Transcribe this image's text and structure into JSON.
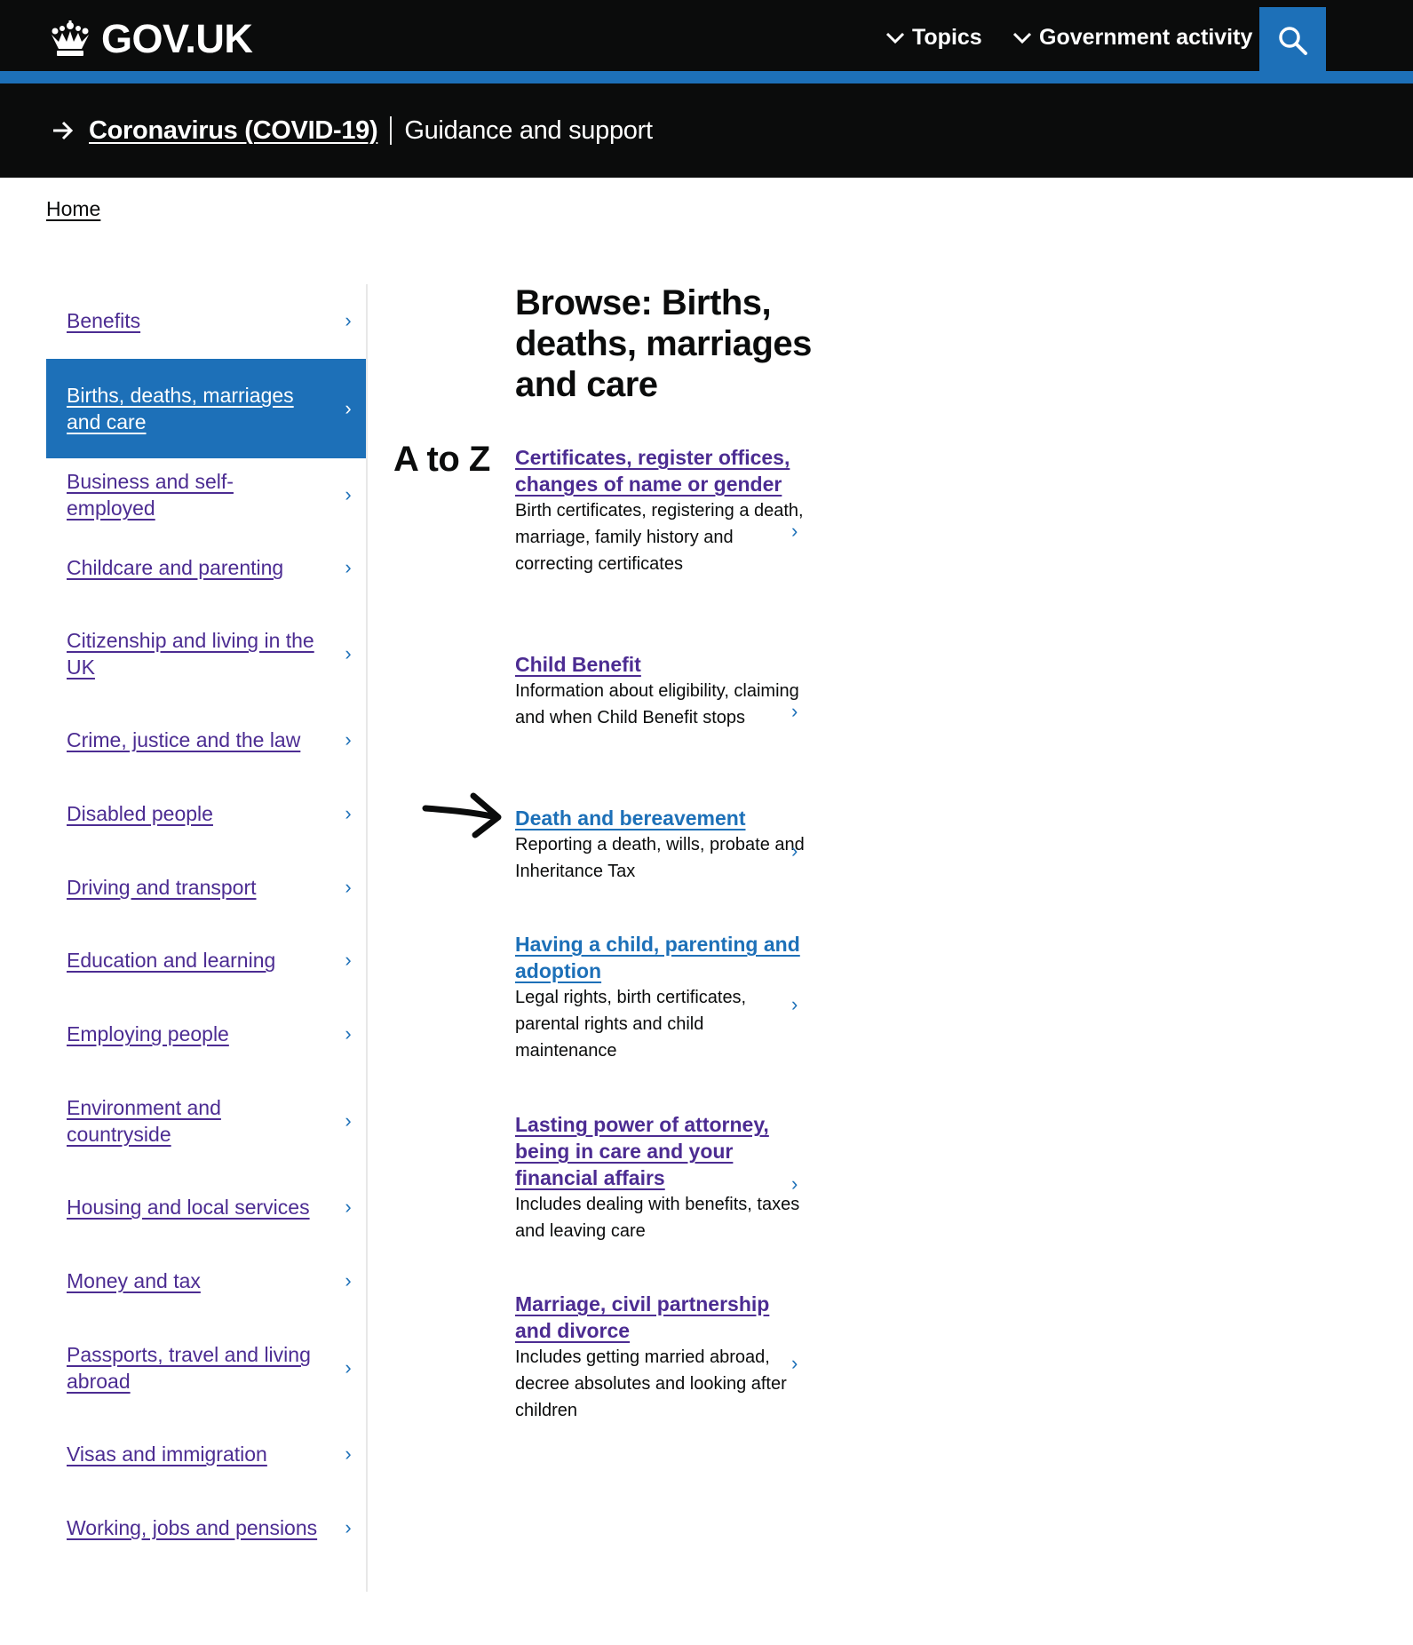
{
  "header": {
    "logo_text": "GOV.UK",
    "nav": [
      {
        "label": "Topics"
      },
      {
        "label": "Government activity"
      }
    ],
    "search_icon": "search-icon",
    "accent_color": "#1d70b8"
  },
  "covid_banner": {
    "link": "Coronavirus (COVID-19)",
    "subtitle": "Guidance and support"
  },
  "breadcrumb": {
    "home": "Home"
  },
  "leftnav": {
    "items": [
      {
        "label": "Benefits",
        "active": false
      },
      {
        "label": "Births, deaths, marriages and care",
        "active": true
      },
      {
        "label": "Business and self-employed",
        "active": false
      },
      {
        "label": "Childcare and parenting",
        "active": false
      },
      {
        "label": "Citizenship and living in the UK",
        "active": false
      },
      {
        "label": "Crime, justice and the law",
        "active": false
      },
      {
        "label": "Disabled people",
        "active": false
      },
      {
        "label": "Driving and transport",
        "active": false
      },
      {
        "label": "Education and learning",
        "active": false
      },
      {
        "label": "Employing people",
        "active": false
      },
      {
        "label": "Environment and countryside",
        "active": false
      },
      {
        "label": "Housing and local services",
        "active": false
      },
      {
        "label": "Money and tax",
        "active": false
      },
      {
        "label": "Passports, travel and living abroad",
        "active": false
      },
      {
        "label": "Visas and immigration",
        "active": false
      },
      {
        "label": "Working, jobs and pensions",
        "active": false
      }
    ],
    "chevron": "›"
  },
  "main": {
    "title": "Browse: Births, deaths, marriages and care",
    "atoz": "A to Z",
    "topics": [
      {
        "title": "Certificates, register offices, changes of name or gender",
        "desc": "Birth certificates, registering a death, marriage, family history and correcting certificates"
      },
      {
        "title": "Child Benefit",
        "desc": "Information about eligibility, claiming and when Child Benefit stops"
      },
      {
        "title": "Death and bereavement",
        "desc": "Reporting a death, wills, probate and Inheritance Tax"
      },
      {
        "title": "Having a child, parenting and adoption",
        "desc": "Legal rights, birth certificates, parental rights and child maintenance"
      },
      {
        "title": "Lasting power of attorney, being in care and your financial affairs",
        "desc": "Includes dealing with benefits, taxes and leaving care"
      },
      {
        "title": "Marriage, civil partnership and divorce",
        "desc": "Includes getting married abroad, decree absolutes and looking after children"
      }
    ]
  }
}
